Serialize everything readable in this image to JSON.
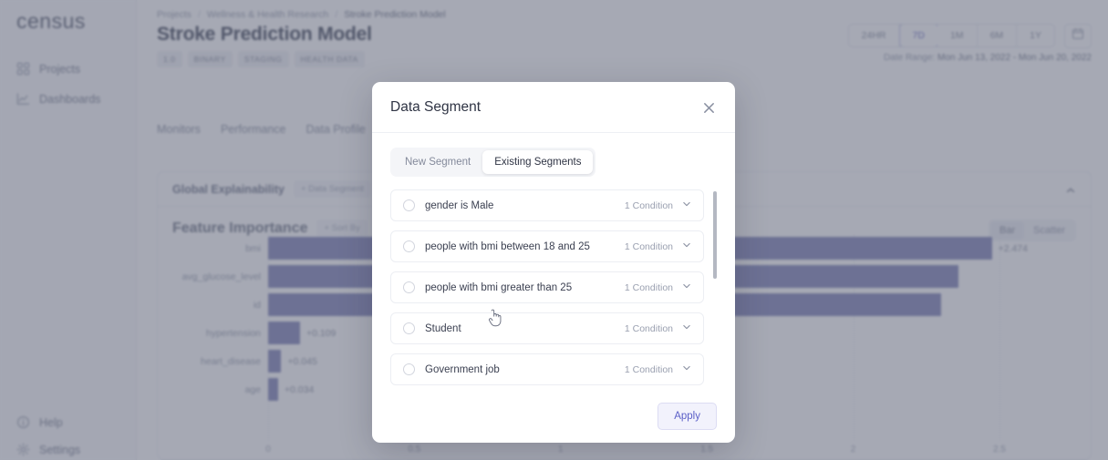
{
  "sidebar": {
    "logo": "census",
    "items": [
      {
        "label": "Projects",
        "icon": "grid-icon"
      },
      {
        "label": "Dashboards",
        "icon": "chart-line-icon"
      }
    ],
    "footer_items": [
      {
        "label": "Help",
        "icon": "info-icon"
      },
      {
        "label": "Settings",
        "icon": "gear-icon"
      }
    ]
  },
  "header": {
    "breadcrumb": [
      "Projects",
      "Wellness & Health Research",
      "Stroke Prediction Model"
    ],
    "breadcrumb_separator": "/",
    "title": "Stroke Prediction Model",
    "tags": [
      "1.0",
      "BINARY",
      "STAGING",
      "HEALTH DATA"
    ],
    "range_buttons": [
      "24HR",
      "7D",
      "1M",
      "6M",
      "1Y"
    ],
    "range_active": "7D",
    "calendar_icon": "calendar-icon",
    "date_range_label": "Date Range:",
    "date_range_value": "Mon Jun 13, 2022 - Mon Jun 20, 2022"
  },
  "tabs": [
    {
      "label": "Monitors"
    },
    {
      "label": "Performance"
    },
    {
      "label": "Data Profile"
    }
  ],
  "card": {
    "section_title": "Global Explainability",
    "section_chip": "+ Data Segment",
    "collapse_icon": "chevron-up-icon",
    "sub_title": "Feature Importance",
    "sub_chip": "+ Sort By",
    "view_toggle": [
      "Bar",
      "Scatter"
    ],
    "view_active": "Bar"
  },
  "chart_data": {
    "type": "bar",
    "orientation": "horizontal",
    "title": "Feature Importance",
    "xlabel": "",
    "ylabel": "",
    "categories": [
      "bmi",
      "avg_glucose_level",
      "id",
      "hypertension",
      "heart_disease",
      "age"
    ],
    "values": [
      2.474,
      2.36,
      2.3,
      0.109,
      0.045,
      0.034
    ],
    "value_labels": [
      "+2.474",
      "",
      "",
      "+0.109",
      "+0.045",
      "+0.034"
    ],
    "xticks": [
      "0",
      "0.5",
      "1",
      "1.5",
      "2",
      "2.5"
    ],
    "xlim": [
      0,
      2.6
    ],
    "grid": true,
    "bar_color": "#8084b8"
  },
  "modal": {
    "title": "Data Segment",
    "close_icon": "close-icon",
    "tabs": [
      {
        "label": "New Segment",
        "active": false
      },
      {
        "label": "Existing Segments",
        "active": true
      }
    ],
    "segments": [
      {
        "label": "gender is Male",
        "conditions": "1 Condition",
        "selected": false
      },
      {
        "label": "people with bmi between 18 and 25",
        "conditions": "1 Condition",
        "selected": false
      },
      {
        "label": "people with bmi greater than 25",
        "conditions": "1 Condition",
        "selected": false
      },
      {
        "label": "Student",
        "conditions": "1 Condition",
        "selected": false
      },
      {
        "label": "Government job",
        "conditions": "1 Condition",
        "selected": false
      }
    ],
    "expand_icon": "chevron-down-icon",
    "apply_label": "Apply"
  },
  "colors": {
    "accent": "#5b5fc7",
    "bar": "#8084b8",
    "overlay": "rgba(92,99,119,0.55)"
  }
}
